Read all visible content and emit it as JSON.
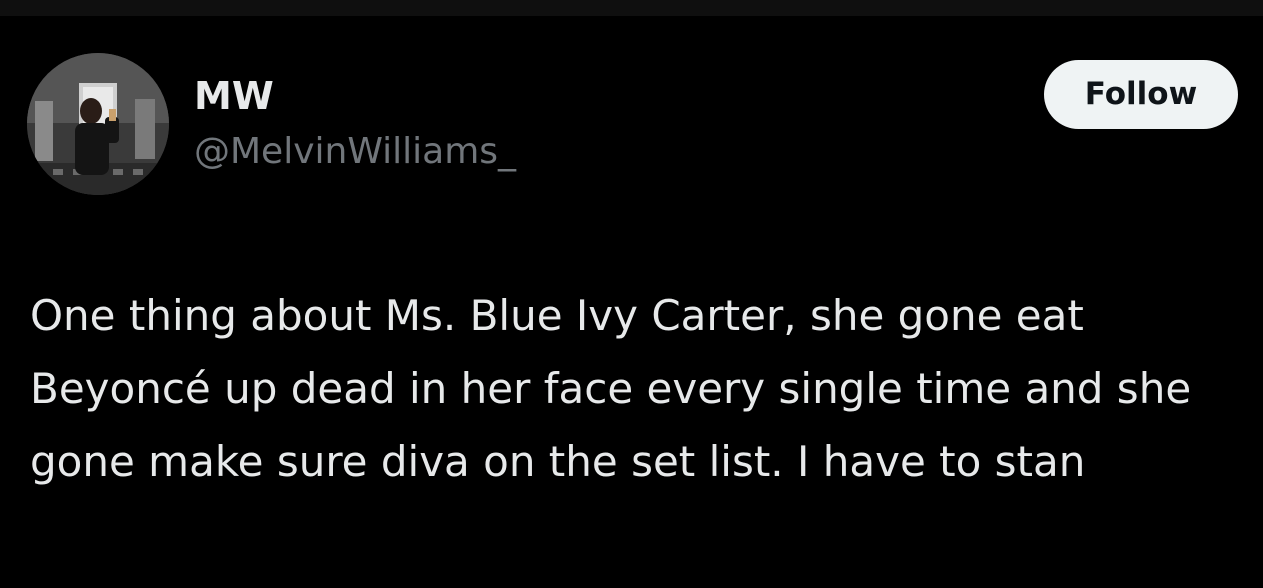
{
  "tweet": {
    "author": {
      "display_name": "MW",
      "handle": "@MelvinWilliams_",
      "avatar_icon": "profile-photo"
    },
    "follow_label": "Follow",
    "text": "One thing about Ms. Blue Ivy Carter, she gone eat Beyoncé up dead in her face every single time and she gone make sure diva on the set list. I have to stan"
  },
  "colors": {
    "background": "#000000",
    "primary_text": "#e7e9ea",
    "secondary_text": "#71767b",
    "follow_button_bg": "#eff3f4",
    "follow_button_text": "#0f1419"
  }
}
